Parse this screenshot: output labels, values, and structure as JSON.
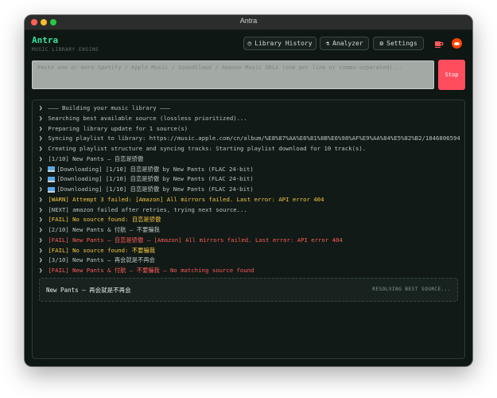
{
  "window": {
    "title": "Antra"
  },
  "brand": {
    "name": "Antra",
    "subtitle": "MUSIC LIBRARY ENGINE"
  },
  "nav": {
    "history_label": "Library History",
    "analyzer_label": "Analyzer",
    "settings_label": "Settings",
    "icons": [
      "clock-icon",
      "flask-icon",
      "gear-icon",
      "coffee-icon",
      "reddit-icon"
    ]
  },
  "input": {
    "placeholder": "Paste one or more Spotify / Apple Music / SoundCloud / Amazon Music URLs (one per line or comma-separated)..."
  },
  "stop_button": {
    "label": "Stop",
    "color": "#ff4d5e"
  },
  "log": [
    {
      "text": "——— Building your music library ———",
      "level": "normal"
    },
    {
      "text": "Searching best available source (lossless prioritized)...",
      "level": "normal"
    },
    {
      "text": "Preparing library update for 1 source(s)",
      "level": "normal"
    },
    {
      "text": "Syncing playlist to library: https://music.apple.com/cn/album/%E8%87%AA%E6%81%8B%E6%98%AF%E9%AA%84%E5%82%B2/1846806594",
      "level": "normal"
    },
    {
      "text": "Creating playlist structure and syncing tracks: Starting playlist download for 10 track(s).",
      "level": "normal"
    },
    {
      "text": "[1/10] New Pants – 自恋是骄傲",
      "level": "normal"
    },
    {
      "text": "[Downloading] [1/10] 自恋是骄傲 by New Pants (FLAC 24-bit)",
      "level": "download"
    },
    {
      "text": "[Downloading] [1/10] 自恋是骄傲 by New Pants (FLAC 24-bit)",
      "level": "download"
    },
    {
      "text": "[Downloading] [1/10] 自恋是骄傲 by New Pants (FLAC 24-bit)",
      "level": "download"
    },
    {
      "text": "[WARN] Attempt 3 failed: [Amazon] All mirrors failed. Last error: API error 404",
      "level": "warn"
    },
    {
      "text": "[NEXT] amazon failed after retries, trying next source...",
      "level": "normal"
    },
    {
      "text": "[FAIL] No source found: 自恋是骄傲",
      "level": "warn"
    },
    {
      "text": "[2/10] New Pants & 付航 – 不要骗我",
      "level": "normal"
    },
    {
      "text": "[FAIL] New Pants – 自恋是骄傲 – [Amazon] All mirrors failed. Last error: API error 404",
      "level": "fail"
    },
    {
      "text": "[FAIL] No source found: 不要骗我",
      "level": "warn"
    },
    {
      "text": "[3/10] New Pants – 再会就是不再会",
      "level": "normal"
    },
    {
      "text": "[FAIL] New Pants & 付航 – 不要骗我 – No matching source found",
      "level": "fail"
    }
  ],
  "status": {
    "track": "New Pants – 再会就是不再会",
    "state": "RESOLVING BEST SOURCE..."
  },
  "colors": {
    "accent": "#35e39a",
    "warn": "#f4c542",
    "fail": "#ff5a5a"
  }
}
